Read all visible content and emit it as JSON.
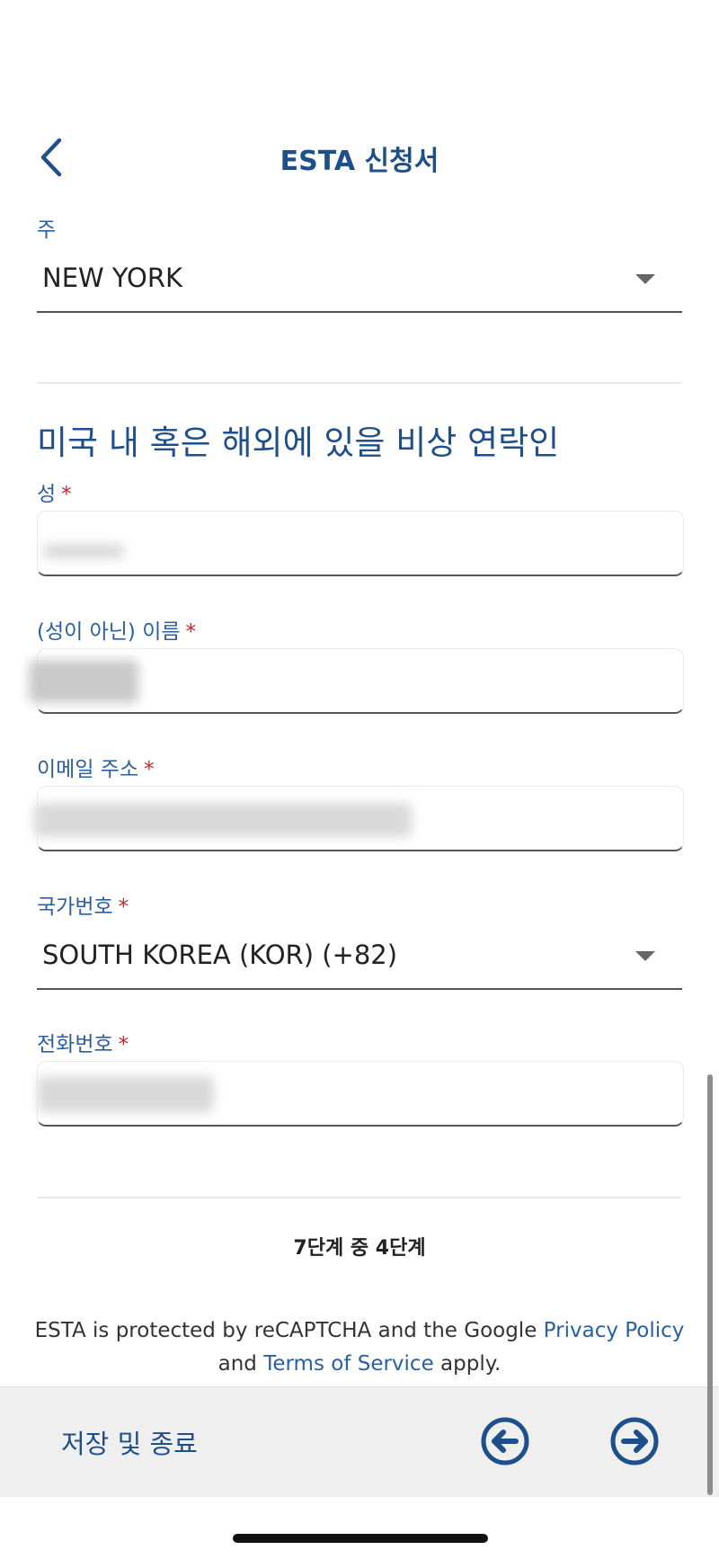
{
  "header": {
    "title": "ESTA 신청서"
  },
  "state_field": {
    "label": "주",
    "value": "NEW YORK"
  },
  "emergency": {
    "section_title": "미국 내 혹은 해외에 있을 비상 연락인",
    "surname": {
      "label": "성",
      "required": "*"
    },
    "given_name": {
      "label": "(성이 아닌) 이름",
      "required": "*"
    },
    "email": {
      "label": "이메일 주소",
      "required": "*"
    },
    "country_code": {
      "label": "국가번호",
      "required": "*",
      "value": "SOUTH KOREA (KOR) (+82)"
    },
    "phone": {
      "label": "전화번호",
      "required": "*"
    }
  },
  "step_indicator": "7단계 중 4단계",
  "recaptcha": {
    "text1": "ESTA is protected by reCAPTCHA and the Google ",
    "privacy_link": "Privacy Policy",
    "text2": "and ",
    "terms_link": "Terms of Service",
    "text3": " apply."
  },
  "bottom_bar": {
    "save_label": "저장 및 종료"
  },
  "colors": {
    "accent": "#1f4f8a",
    "label": "#2a5fa0",
    "required": "#c0282a"
  }
}
